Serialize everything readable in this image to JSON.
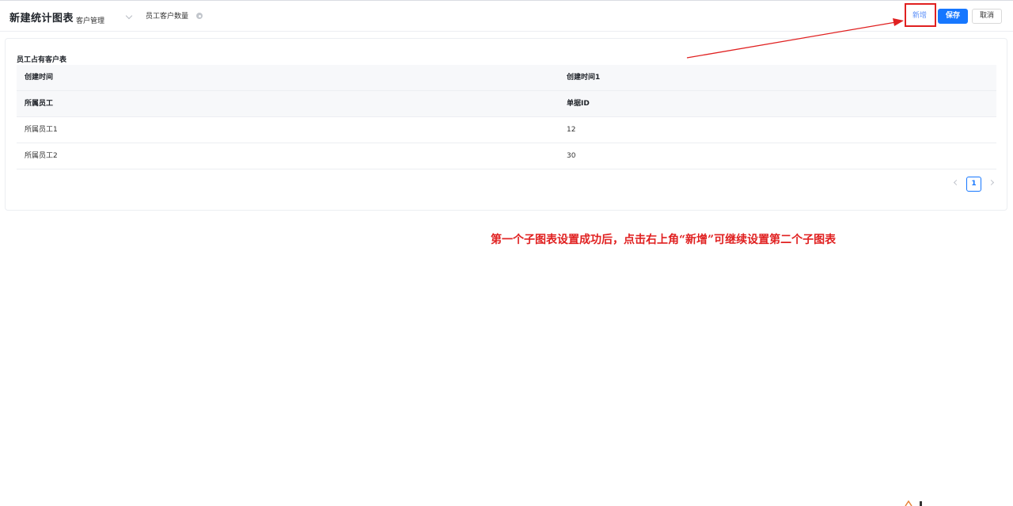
{
  "header": {
    "title": "新建统计图表",
    "module_select": "客户管理",
    "chart_name": "员工客户数量",
    "add_label": "新增",
    "save_label": "保存",
    "cancel_label": "取消"
  },
  "card": {
    "title": "员工占有客户表",
    "rows": [
      {
        "c1": "创建时间",
        "c2": "创建时间1",
        "head": true
      },
      {
        "c1": "所属员工",
        "c2": "单据ID",
        "head": true
      },
      {
        "c1": "所属员工1",
        "c2": "12",
        "head": false
      },
      {
        "c1": "所属员工2",
        "c2": "30",
        "head": false
      }
    ],
    "pagination": {
      "current": "1"
    }
  },
  "annotation": {
    "text": "第一个子图表设置成功后，点击右上角“新增”可继续设置第二个子图表"
  },
  "colors": {
    "primary": "#1677ff",
    "annotation_red": "#e02020",
    "add_text": "#5b8ff9"
  }
}
